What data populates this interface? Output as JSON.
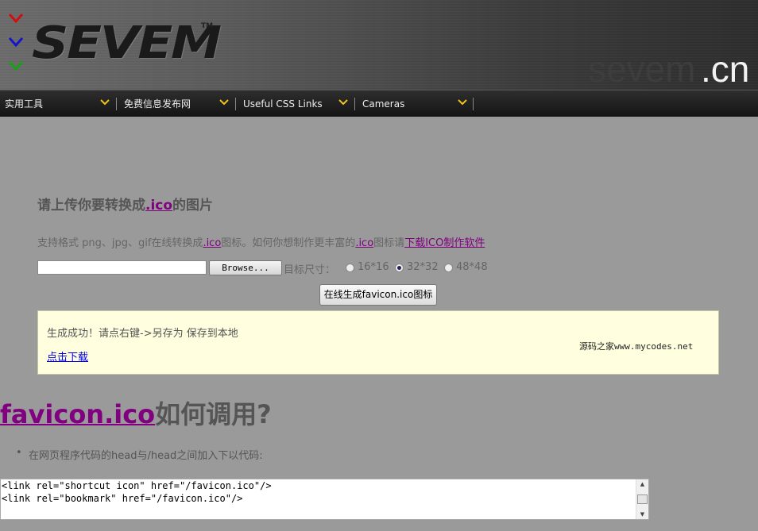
{
  "header": {
    "logo_text": "SEVEM",
    "logo_tm": "TM",
    "domain_name": "sevem",
    "domain_tld": ".cn"
  },
  "nav": {
    "items": [
      {
        "label": "实用工具"
      },
      {
        "label": "免费信息发布网"
      },
      {
        "label": "Useful CSS Links"
      },
      {
        "label": "Cameras"
      }
    ],
    "arrow_color": "#f5c518"
  },
  "upload": {
    "title_pre": "请上传你要转换成",
    "title_link": ".ico",
    "title_post": "的图片",
    "desc_pre": "支持格式 png、jpg、gif在线转换成",
    "desc_link1": ".ico",
    "desc_mid": "图标。如何你想制作更丰富的",
    "desc_link2": ".ico",
    "desc_mid2": "图标请",
    "desc_link3": "下载ICO制作软件",
    "browse_label": "Browse...",
    "size_label": "目标尺寸：",
    "sizes": [
      "16*16",
      "32*32",
      "48*48"
    ],
    "selected_size": "32*32",
    "generate_label": "在线生成favicon.ico图标"
  },
  "result": {
    "message": "生成成功！请点右键->另存为 保存到本地",
    "download_label": "点击下载",
    "watermark": "源码之家www.mycodes.net"
  },
  "howto": {
    "heading_link1": "favicon",
    "heading_link2": ".ico",
    "heading_post": "如何调用?",
    "bullet": "在网页程序代码的head与/head之间加入下以代码:",
    "code_lines": [
      "<link rel=\"shortcut icon\" href=\"/favicon.ico\"/>",
      "<link rel=\"bookmark\" href=\"/favicon.ico\"/>"
    ]
  },
  "colors": {
    "link_purple": "#800080",
    "result_bg": "#ffffe0",
    "page_bg": "#9a9a9a"
  }
}
